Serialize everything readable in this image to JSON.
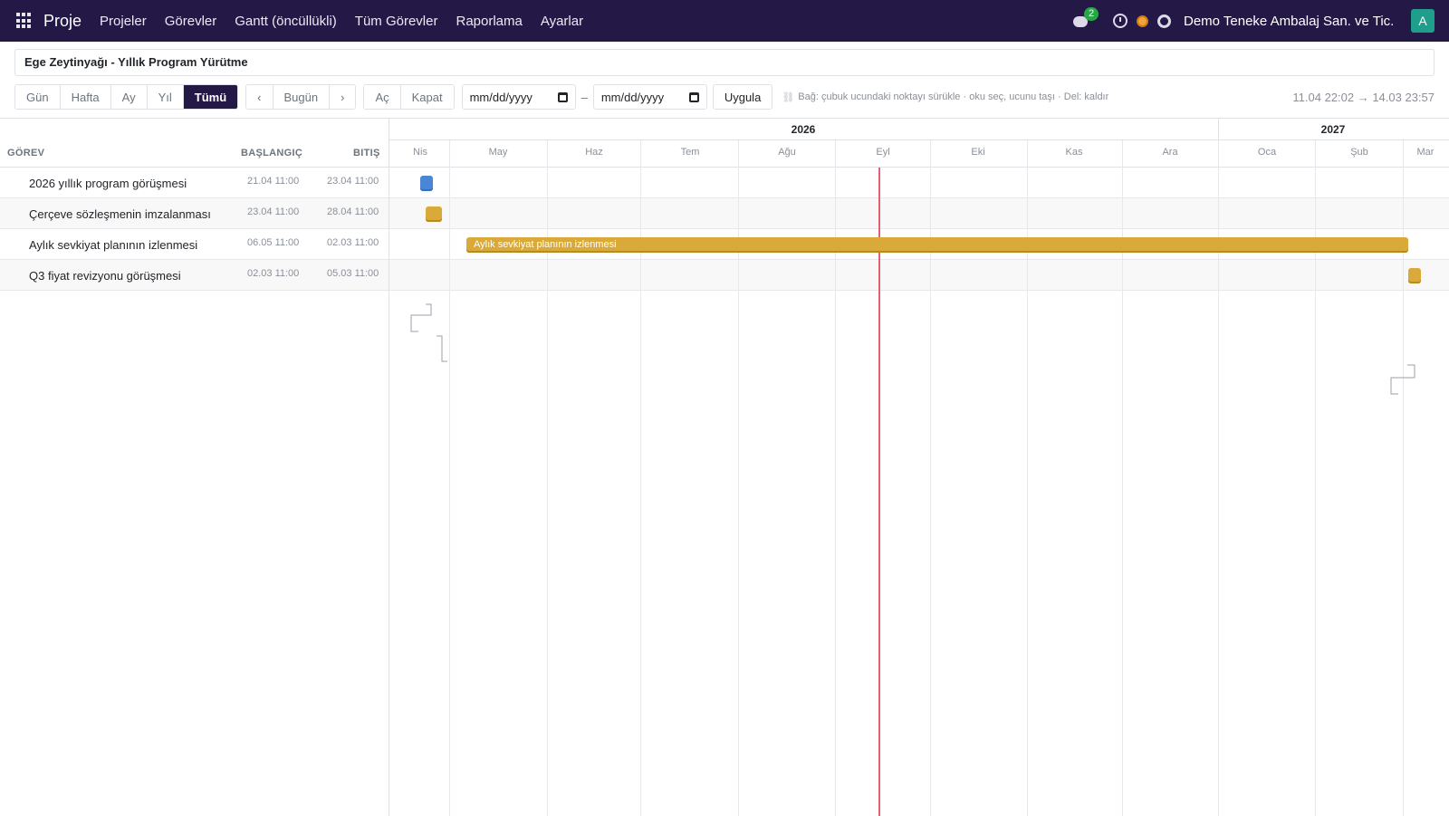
{
  "topbar": {
    "brand": "Proje",
    "menu": [
      "Projeler",
      "Görevler",
      "Gantt (öncüllükli)",
      "Tüm Görevler",
      "Raporlama",
      "Ayarlar"
    ],
    "chat_count": "2",
    "company": "Demo Teneke Ambalaj San. ve Tic. ...",
    "avatar_letter": "A",
    "icons": [
      "apps-icon",
      "chat-icon",
      "clock-icon",
      "activity-icon",
      "support-icon"
    ]
  },
  "title": "Ege Zeytinyağı - Yıllık Program Yürütme",
  "toolbar": {
    "scale_buttons": [
      "Gün",
      "Hafta",
      "Ay",
      "Yıl",
      "Tümü"
    ],
    "active_scale": "Tümü",
    "prev": "‹",
    "today": "Bugün",
    "next": "›",
    "expand": "Aç",
    "collapse": "Kapat",
    "date_from": "mm/dd/yyyy",
    "date_to": "mm/dd/yyyy",
    "dash": "–",
    "apply": "Uygula",
    "hint": "Bağ: çubuk ucundaki noktayı sürükle · oku seç, ucunu taşı · Del: kaldır",
    "range": "11.04 22:02 → 14.03 23:57"
  },
  "columns": {
    "task": "GÖREV",
    "start": "BAŞLANGIÇ",
    "end": "BITIŞ"
  },
  "tasks": [
    {
      "name": "2026 yıllık program görüşmesi",
      "start": "21.04 11:00",
      "end": "23.04 11:00",
      "color": "#4a86d6"
    },
    {
      "name": "Çerçeve sözleşmenin imzalanması",
      "start": "23.04 11:00",
      "end": "28.04 11:00",
      "color": "#d9a93a"
    },
    {
      "name": "Aylık sevkiyat planının izlenmesi",
      "start": "06.05 11:00",
      "end": "02.03 11:00",
      "color": "#d9a93a"
    },
    {
      "name": "Q3 fiyat revizyonu görüşmesi",
      "start": "02.03 11:00",
      "end": "05.03 11:00",
      "color": "#d9a93a"
    }
  ],
  "timeline": {
    "years": [
      "2026",
      "2027"
    ],
    "months": [
      "Nis",
      "May",
      "Haz",
      "Tem",
      "Ağu",
      "Eyl",
      "Eki",
      "Kas",
      "Ara",
      "Oca",
      "Şub",
      "Mar"
    ]
  },
  "bar_label": "Aylık sevkiyat planının izlenmesi"
}
